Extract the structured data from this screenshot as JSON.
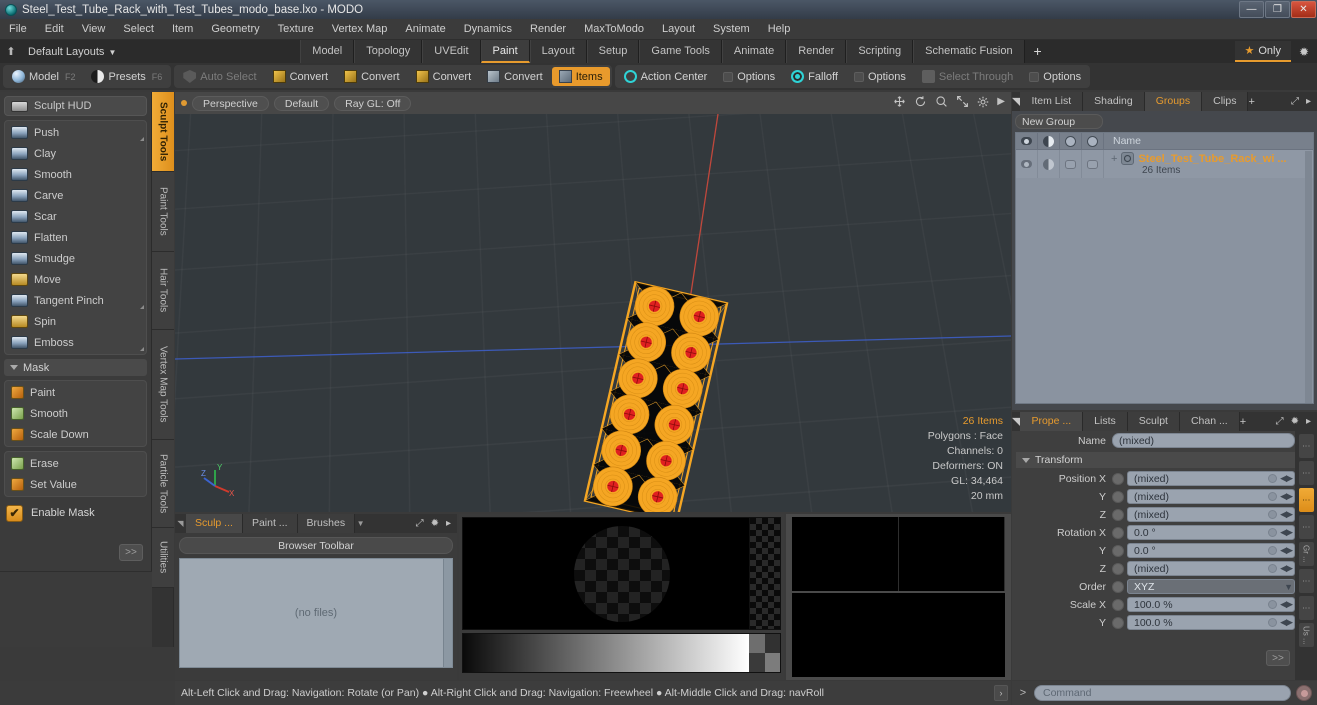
{
  "window": {
    "title": "Steel_Test_Tube_Rack_with_Test_Tubes_modo_base.lxo - MODO",
    "app_icon": "modo-logo-icon",
    "minimize": "—",
    "maximize": "❐",
    "close": "✕"
  },
  "menubar": {
    "items": [
      "File",
      "Edit",
      "View",
      "Select",
      "Item",
      "Geometry",
      "Texture",
      "Vertex Map",
      "Animate",
      "Dynamics",
      "Render",
      "MaxToModo",
      "Layout",
      "System",
      "Help"
    ]
  },
  "layoutbar": {
    "home_icon": "home-icon",
    "layouts_label": "Default Layouts",
    "caret": "▼",
    "tabs": [
      {
        "label": "Model",
        "active": false
      },
      {
        "label": "Topology",
        "active": false
      },
      {
        "label": "UVEdit",
        "active": false
      },
      {
        "label": "Paint",
        "active": true
      },
      {
        "label": "Layout",
        "active": false
      },
      {
        "label": "Setup",
        "active": false
      },
      {
        "label": "Game Tools",
        "active": false
      },
      {
        "label": "Animate",
        "active": false
      },
      {
        "label": "Render",
        "active": false
      },
      {
        "label": "Scripting",
        "active": false
      },
      {
        "label": "Schematic Fusion",
        "active": false
      }
    ],
    "plus": "+",
    "only_label": "Only",
    "only_star": "★",
    "gear": "✹"
  },
  "modebar": {
    "group1": [
      {
        "label": "Model",
        "hotkey": "F2",
        "icon": "sphere-icon",
        "state": "normal"
      },
      {
        "label": "Presets",
        "hotkey": "F6",
        "icon": "half-sphere-icon",
        "state": "normal"
      }
    ],
    "group2": [
      {
        "label": "Auto Select",
        "icon": "shield-icon",
        "state": "dim"
      },
      {
        "label": "Convert",
        "icon": "cube-yellow-icon",
        "state": "normal"
      },
      {
        "label": "Convert",
        "icon": "cube-yellow-icon",
        "state": "normal"
      },
      {
        "label": "Convert",
        "icon": "cube-yellow-icon",
        "state": "normal"
      },
      {
        "label": "Convert",
        "icon": "cube-grey-icon",
        "state": "normal"
      },
      {
        "label": "Items",
        "icon": "cube-icon",
        "state": "active"
      }
    ],
    "group3": [
      {
        "label": "Action Center",
        "icon": "target-icon",
        "state": "normal"
      },
      {
        "label": "Options",
        "icon": "square-icon",
        "state": "normal"
      },
      {
        "label": "Falloff",
        "icon": "falloff-icon",
        "state": "normal"
      },
      {
        "label": "Options",
        "icon": "square-icon",
        "state": "normal"
      },
      {
        "label": "Select Through",
        "icon": "select-through-icon",
        "state": "dim"
      },
      {
        "label": "Options",
        "icon": "square-icon",
        "state": "normal"
      }
    ]
  },
  "left_panel": {
    "hud_label": "Sculpt HUD",
    "hud_icon": "hud-icon",
    "sculpt_tools": [
      {
        "label": "Push",
        "icon": "brush-push-icon",
        "corner": true
      },
      {
        "label": "Clay",
        "icon": "brush-clay-icon",
        "corner": false
      },
      {
        "label": "Smooth",
        "icon": "brush-smooth-icon",
        "corner": false
      },
      {
        "label": "Carve",
        "icon": "brush-carve-icon",
        "corner": false
      },
      {
        "label": "Scar",
        "icon": "brush-scar-icon",
        "corner": false
      },
      {
        "label": "Flatten",
        "icon": "brush-flatten-icon",
        "corner": false
      },
      {
        "label": "Smudge",
        "icon": "brush-smudge-icon",
        "corner": false
      },
      {
        "label": "Move",
        "icon": "brush-move-icon",
        "corner": false
      },
      {
        "label": "Tangent Pinch",
        "icon": "brush-pinch-icon",
        "corner": true
      },
      {
        "label": "Spin",
        "icon": "brush-spin-icon",
        "corner": false
      },
      {
        "label": "Emboss",
        "icon": "brush-emboss-icon",
        "corner": true
      }
    ],
    "mask_section": "Mask",
    "mask_tools": [
      {
        "label": "Paint",
        "icon": "mask-paint-icon"
      },
      {
        "label": "Smooth",
        "icon": "mask-smooth-icon"
      },
      {
        "label": "Scale Down",
        "icon": "mask-scale-down-icon"
      }
    ],
    "mask_tools2": [
      {
        "label": "Erase",
        "icon": "mask-erase-icon"
      },
      {
        "label": "Set Value",
        "icon": "mask-set-value-icon"
      }
    ],
    "enable_mask": "Enable Mask",
    "enable_mask_checked": true,
    "expand": ">>"
  },
  "vertical_tabs": [
    {
      "label": "Sculpt Tools",
      "active": true
    },
    {
      "label": "Paint Tools",
      "active": false
    },
    {
      "label": "Hair Tools",
      "active": false
    },
    {
      "label": "Vertex Map Tools",
      "active": false
    },
    {
      "label": "Particle Tools",
      "active": false
    },
    {
      "label": "Utilities",
      "active": false
    }
  ],
  "viewport": {
    "buttons": [
      "Perspective",
      "Default",
      "Ray GL: Off"
    ],
    "tool_icons": [
      "move-icon",
      "rotate-icon",
      "zoom-icon",
      "fit-icon",
      "gear-icon",
      "chevron-right-icon"
    ],
    "stats": {
      "items": "26 Items",
      "polygons": "Polygons : Face",
      "channels": "Channels: 0",
      "deformers": "Deformers: ON",
      "gl": "GL: 34,464",
      "scale": "20 mm"
    },
    "axis_labels": {
      "x": "X",
      "y": "Y",
      "z": "Z"
    },
    "model_color": "#f5a623",
    "model_accent": "#e02020",
    "grid_color": "#3c4247",
    "background": "#33393d"
  },
  "browser": {
    "tabs": [
      {
        "label": "Sculp ...",
        "active": true
      },
      {
        "label": "Paint ...",
        "active": false
      },
      {
        "label": "Brushes",
        "active": false
      }
    ],
    "dropdown_caret": "▼",
    "extra_icons": [
      "expand-icon",
      "gear-icon",
      "chevron-right-icon"
    ],
    "toolbar_label": "Browser Toolbar",
    "empty_label": "(no files)"
  },
  "right_panel": {
    "tabs": [
      {
        "label": "Item List",
        "active": false
      },
      {
        "label": "Shading",
        "active": false
      },
      {
        "label": "Groups",
        "active": true
      },
      {
        "label": "Clips",
        "active": false
      }
    ],
    "plus": "+",
    "extra_icons": [
      "expand-icon",
      "chevron-right-icon"
    ],
    "new_group_button": "New Group",
    "column_headers": {
      "visibility": "eye-icon",
      "render": "half-circle-icon",
      "lock": "lock-icon",
      "info": "info-icon",
      "name": "Name"
    },
    "rows": [
      {
        "expand": "+",
        "icon": "group-icon",
        "name": "Steel_Test_Tube_Rack_wi ...",
        "sub": "26 Items"
      }
    ]
  },
  "properties": {
    "tabs": [
      {
        "label": "Prope ...",
        "active": true
      },
      {
        "label": "Lists",
        "active": false
      },
      {
        "label": "Sculpt",
        "active": false
      },
      {
        "label": "Chan ...",
        "active": false
      }
    ],
    "plus": "+",
    "extra_icons": [
      "expand-icon",
      "gear-icon",
      "chevron-right-icon"
    ],
    "name_label": "Name",
    "name_value": "(mixed)",
    "transform_label": "Transform",
    "fields": [
      {
        "label": "Position X",
        "value": "(mixed)",
        "type": "num"
      },
      {
        "label": "Y",
        "value": "(mixed)",
        "type": "num"
      },
      {
        "label": "Z",
        "value": "(mixed)",
        "type": "num"
      },
      {
        "label": "Rotation X",
        "value": "0.0 °",
        "type": "num"
      },
      {
        "label": "Y",
        "value": "0.0 °",
        "type": "num"
      },
      {
        "label": "Z",
        "value": "(mixed)",
        "type": "num"
      },
      {
        "label": "Order",
        "value": "XYZ",
        "type": "select"
      },
      {
        "label": "Scale X",
        "value": "100.0 %",
        "type": "num"
      },
      {
        "label": "Y",
        "value": "100.0 %",
        "type": "num"
      }
    ],
    "expand": ">>",
    "side_tabs": [
      "",
      "",
      "",
      "",
      "Gr ...",
      "",
      "",
      "Us ..."
    ]
  },
  "statusbar": {
    "text": "Alt-Left Click and Drag: Navigation: Rotate (or Pan) ● Alt-Right Click and Drag: Navigation: Freewheel ● Alt-Middle Click and Drag: navRoll",
    "arrow": "›"
  },
  "commandbar": {
    "prompt": ">",
    "placeholder": "Command",
    "record_icon": "record-icon"
  }
}
